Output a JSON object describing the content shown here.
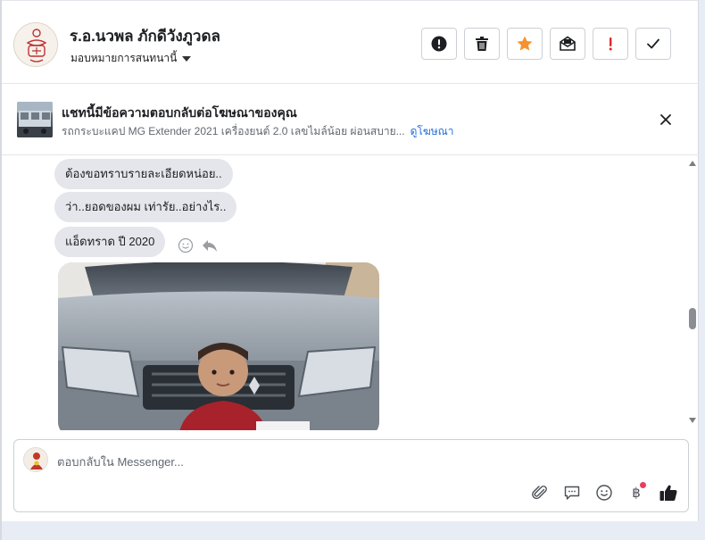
{
  "header": {
    "contact_name": "ร.อ.นวพล ภักดีวังภูวดล",
    "assign_label": "มอบหมายการสนทนานี้",
    "toolbar": [
      {
        "name": "mark-spam-button",
        "icon": "alert-circle-icon"
      },
      {
        "name": "delete-button",
        "icon": "trash-icon"
      },
      {
        "name": "star-button",
        "icon": "star-icon"
      },
      {
        "name": "mark-unread-button",
        "icon": "envelope-icon"
      },
      {
        "name": "follow-up-button",
        "icon": "exclamation-icon"
      },
      {
        "name": "mark-done-button",
        "icon": "check-icon"
      }
    ]
  },
  "ad_banner": {
    "title": "แชทนี้มีข้อความตอบกลับต่อโฆษณาของคุณ",
    "subtitle": "รถกระบะแคป MG Extender 2021 เครื่องยนต์ 2.0 เลขไมล์น้อย ผ่อนสบาย...",
    "link_label": "ดูโฆษณา"
  },
  "messages": [
    {
      "text": "ต้องขอทราบรายละเอียดหน่อย.."
    },
    {
      "text": "ว่า..ยอดของผม เท่ารัย..อย่างไร.."
    },
    {
      "text": "แอ็ดทราด ปี 2020"
    }
  ],
  "composer": {
    "placeholder": "ตอบกลับใน Messenger...",
    "tools": [
      "paperclip-icon",
      "comment-icon",
      "smiley-icon",
      "baht-icon",
      "thumbs-up-icon"
    ],
    "baht_symbol": "฿"
  },
  "colors": {
    "accent_orange": "#f5922f",
    "link_blue": "#216fdb",
    "follow_up_red": "#e02828",
    "bubble_gray": "#e4e6eb"
  }
}
